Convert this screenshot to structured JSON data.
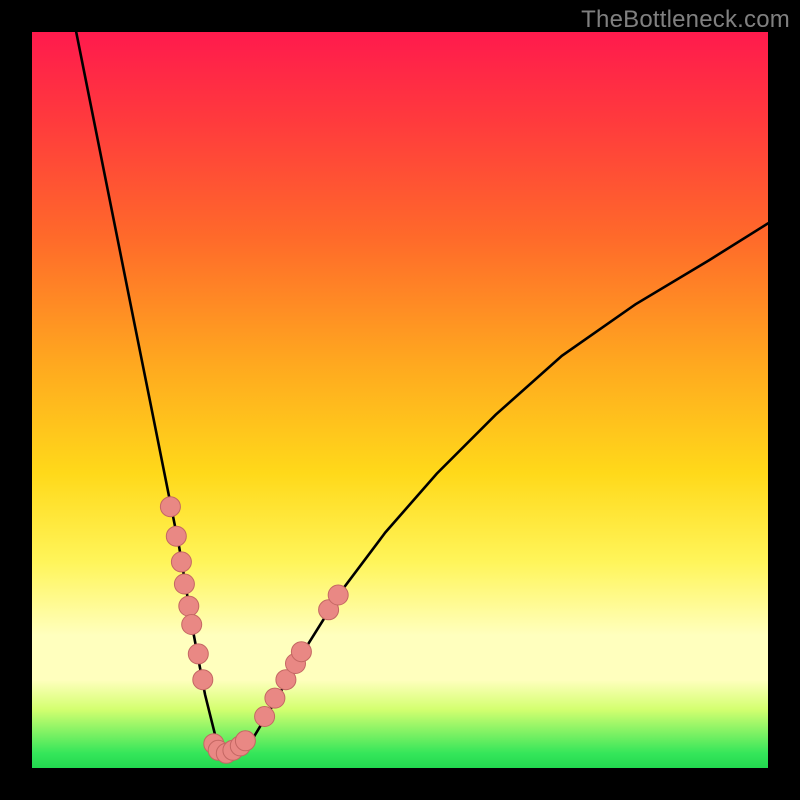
{
  "watermark": "TheBottleneck.com",
  "colors": {
    "background_black": "#000000",
    "gradient_top": "#ff1a4d",
    "gradient_mid1": "#ff6a2a",
    "gradient_mid2": "#ffd91a",
    "gradient_pale": "#ffffbe",
    "gradient_green": "#22d94f",
    "curve": "#000000",
    "dot_fill": "#e98884",
    "dot_stroke": "#c46763"
  },
  "chart_data": {
    "type": "line",
    "title": "",
    "xlabel": "",
    "ylabel": "",
    "xlim": [
      0,
      100
    ],
    "ylim": [
      0,
      100
    ],
    "grid": false,
    "legend": false,
    "series": [
      {
        "name": "bottleneck-curve",
        "x": [
          6,
          8,
          10,
          12,
          14,
          16,
          18,
          20,
          22,
          23.5,
          25,
          26.5,
          28,
          30,
          33,
          37,
          42,
          48,
          55,
          63,
          72,
          82,
          92,
          100
        ],
        "y": [
          100,
          90,
          80,
          70,
          60,
          50,
          40,
          30,
          18,
          10,
          4,
          2,
          2,
          4,
          9,
          16,
          24,
          32,
          40,
          48,
          56,
          63,
          69,
          74
        ]
      }
    ],
    "points": [
      {
        "name": "left-cluster",
        "x": 18.8,
        "y": 35.5
      },
      {
        "name": "left-cluster",
        "x": 19.6,
        "y": 31.5
      },
      {
        "name": "left-cluster",
        "x": 20.3,
        "y": 28.0
      },
      {
        "name": "left-cluster",
        "x": 20.7,
        "y": 25.0
      },
      {
        "name": "left-cluster",
        "x": 21.3,
        "y": 22.0
      },
      {
        "name": "left-cluster",
        "x": 21.7,
        "y": 19.5
      },
      {
        "name": "left-cluster",
        "x": 22.6,
        "y": 15.5
      },
      {
        "name": "left-cluster",
        "x": 23.2,
        "y": 12.0
      },
      {
        "name": "bottom-cluster",
        "x": 24.7,
        "y": 3.3
      },
      {
        "name": "bottom-cluster",
        "x": 25.3,
        "y": 2.4
      },
      {
        "name": "bottom-cluster",
        "x": 26.4,
        "y": 2.0
      },
      {
        "name": "bottom-cluster",
        "x": 27.3,
        "y": 2.4
      },
      {
        "name": "bottom-cluster",
        "x": 28.3,
        "y": 3.0
      },
      {
        "name": "bottom-cluster",
        "x": 29.0,
        "y": 3.7
      },
      {
        "name": "right-cluster",
        "x": 31.6,
        "y": 7.0
      },
      {
        "name": "right-cluster",
        "x": 33.0,
        "y": 9.5
      },
      {
        "name": "right-cluster",
        "x": 34.5,
        "y": 12.0
      },
      {
        "name": "right-cluster",
        "x": 35.8,
        "y": 14.2
      },
      {
        "name": "right-cluster",
        "x": 36.6,
        "y": 15.8
      },
      {
        "name": "right-cluster",
        "x": 40.3,
        "y": 21.5
      },
      {
        "name": "right-cluster",
        "x": 41.6,
        "y": 23.5
      }
    ]
  }
}
